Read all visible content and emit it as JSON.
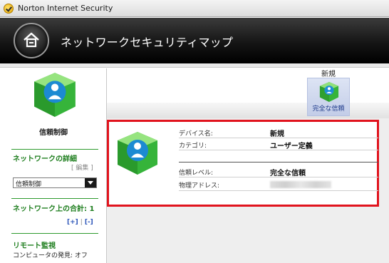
{
  "window": {
    "title": "Norton Internet Security"
  },
  "header": {
    "title": "ネットワークセキュリティマップ",
    "home_icon": "home-icon"
  },
  "device_tab": {
    "heading": "新規",
    "label": "完全な信頼"
  },
  "sidebar": {
    "caption": "信頼制御",
    "network_details": {
      "heading": "ネットワークの詳細",
      "edit_label": "[ 編集 ]"
    },
    "select": {
      "value": "信頼制御"
    },
    "network_total": {
      "label": "ネットワーク上の合計: 1"
    },
    "add_remove": {
      "plus": "[+]",
      "separator": "|",
      "minus": "[-]"
    },
    "remote_monitor": {
      "heading": "リモート監視",
      "discovery": "コンピュータの発見: オフ"
    }
  },
  "details": {
    "device_name": {
      "label": "デバイス名:",
      "value": "新規"
    },
    "category": {
      "label": "カテゴリ:",
      "value": "ユーザー定義"
    },
    "trust_level": {
      "label": "信頼レベル:",
      "value": "完全な信頼"
    },
    "mac_address": {
      "label": "物理アドレス:"
    }
  },
  "colors": {
    "highlight_border": "#e1131d",
    "accent_green": "#1e7e1e",
    "link_blue": "#2b54b8",
    "header_dark": "#151515"
  }
}
